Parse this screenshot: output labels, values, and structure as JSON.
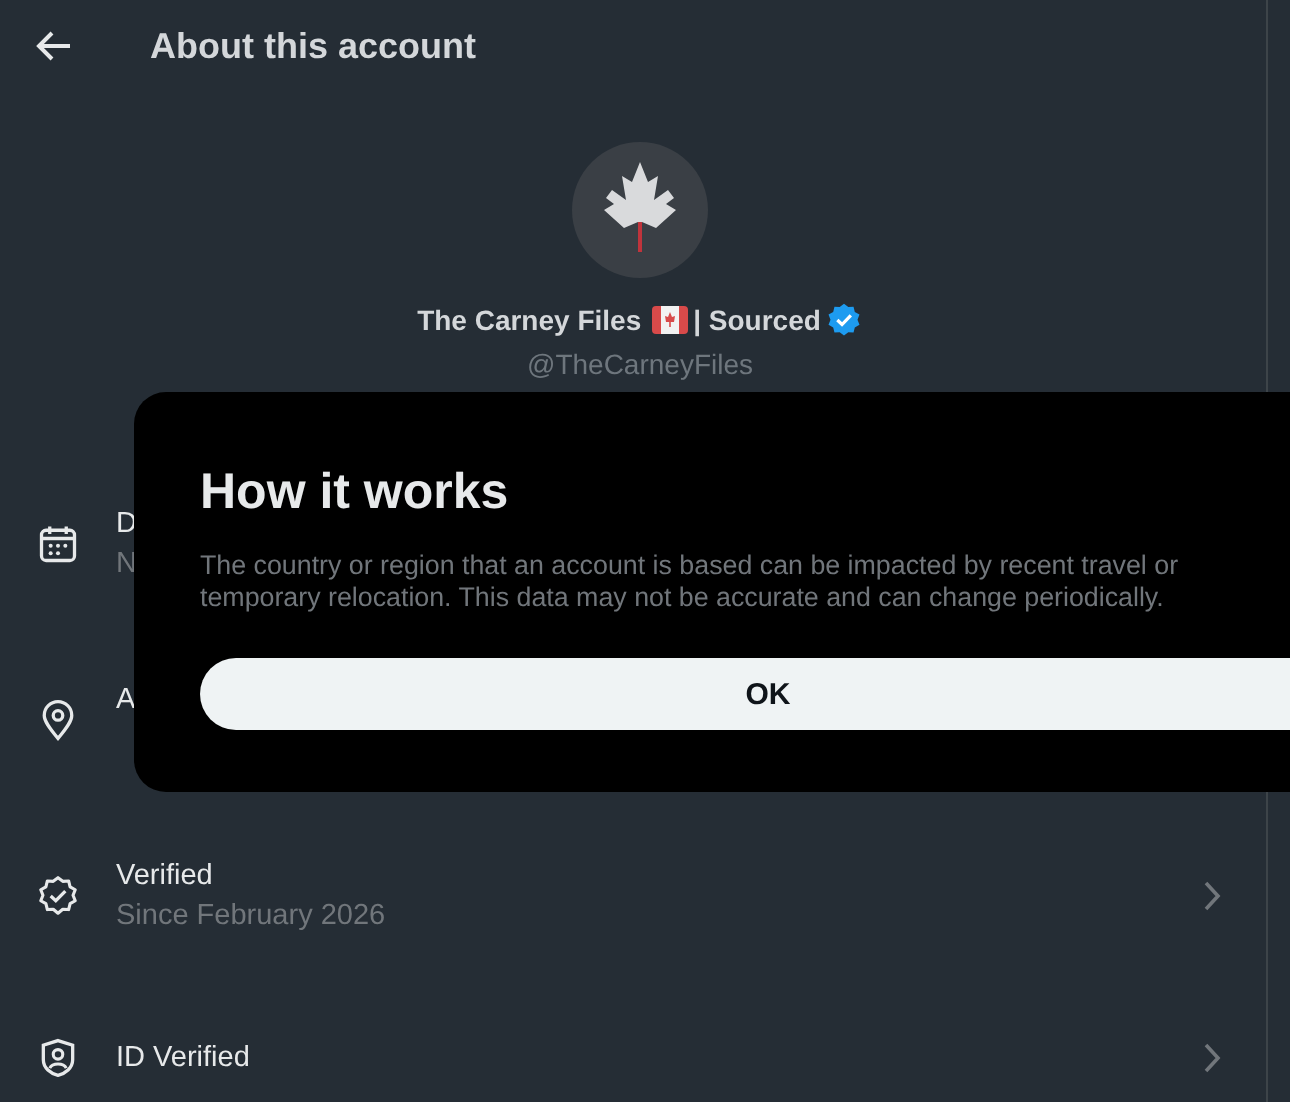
{
  "header": {
    "title": "About this account"
  },
  "profile": {
    "name": "The Carney Files",
    "name_suffix": "| Sourced",
    "verified": true,
    "handle": "@TheCarneyFiles"
  },
  "rows": [
    {
      "kind": "calendar",
      "title": "D",
      "subtitle": "N"
    },
    {
      "kind": "location",
      "title": "A"
    },
    {
      "kind": "verified",
      "title": "Verified",
      "subtitle": "Since February 2026",
      "chevron": true
    },
    {
      "kind": "id",
      "title": "ID Verified",
      "chevron": true
    }
  ],
  "dialog": {
    "title": "How it works",
    "text": "The country or region that an account is based can be impacted by recent travel or temporary relocation. This data may not be accurate and can change periodically.",
    "button": "OK"
  }
}
